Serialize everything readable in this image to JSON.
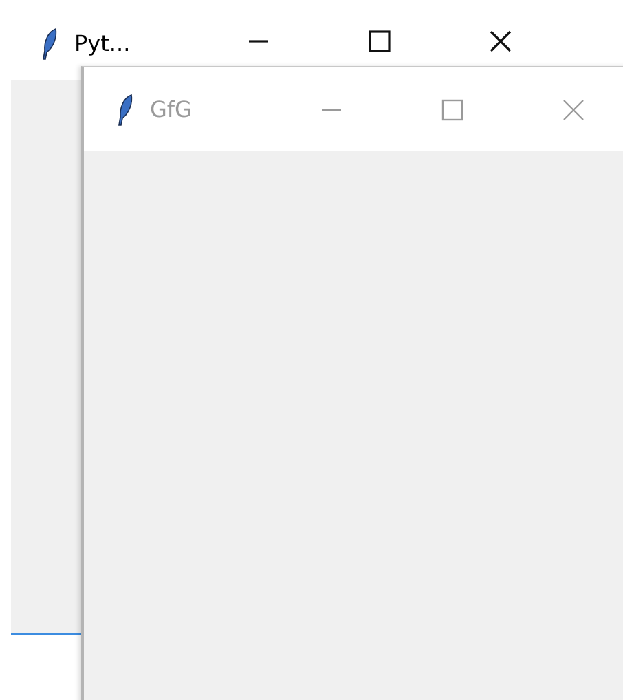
{
  "windows": [
    {
      "title": "Pyt...",
      "active": true
    },
    {
      "title": "GfG",
      "active": false
    }
  ]
}
